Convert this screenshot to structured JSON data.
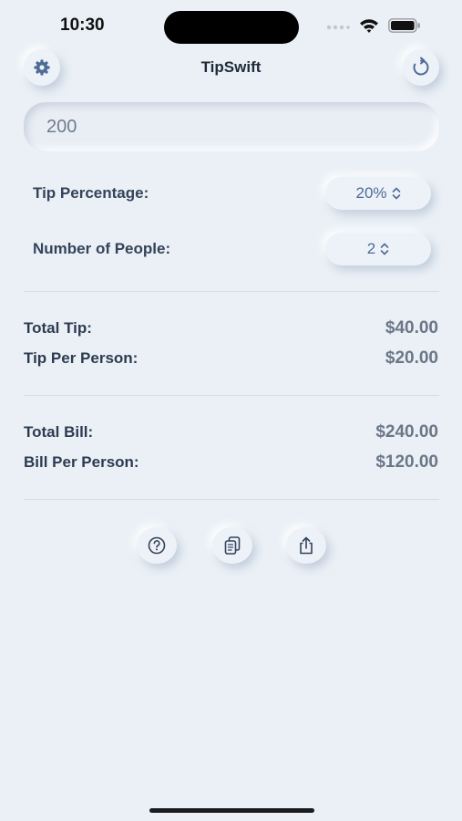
{
  "status_bar": {
    "time": "10:30",
    "icons": [
      "signal-dots-icon",
      "wifi-icon",
      "battery-icon"
    ]
  },
  "nav": {
    "title": "TipSwift",
    "left_icon": "gear-icon",
    "right_icon": "reset-icon"
  },
  "bill": {
    "value": "200"
  },
  "settings": {
    "tip_label": "Tip Percentage:",
    "tip_value": "20%",
    "people_label": "Number of People:",
    "people_value": "2"
  },
  "results": {
    "total_tip_label": "Total Tip:",
    "total_tip_value": "$40.00",
    "tip_per_person_label": "Tip Per Person:",
    "tip_per_person_value": "$20.00",
    "total_bill_label": "Total Bill:",
    "total_bill_value": "$240.00",
    "bill_per_person_label": "Bill Per Person:",
    "bill_per_person_value": "$120.00"
  },
  "actions": [
    "help-icon",
    "copy-icon",
    "share-icon"
  ],
  "colors": {
    "background": "#eaf0f6",
    "accent": "#4e6b95",
    "text": "#2b3a4f"
  }
}
